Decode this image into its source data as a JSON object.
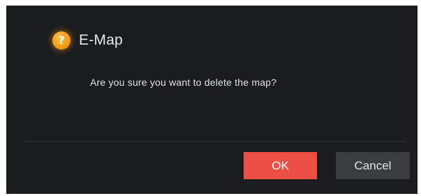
{
  "dialog": {
    "title": "E-Map",
    "title_icon": "question-icon",
    "icon_glyph": "?",
    "message": "Are you sure you want to delete the map?",
    "ok_label": "OK",
    "cancel_label": "Cancel"
  },
  "colors": {
    "background": "#1b1c1e",
    "ok_button": "#ee4f45",
    "cancel_button": "#3a3c40",
    "icon": "#f59b12"
  }
}
